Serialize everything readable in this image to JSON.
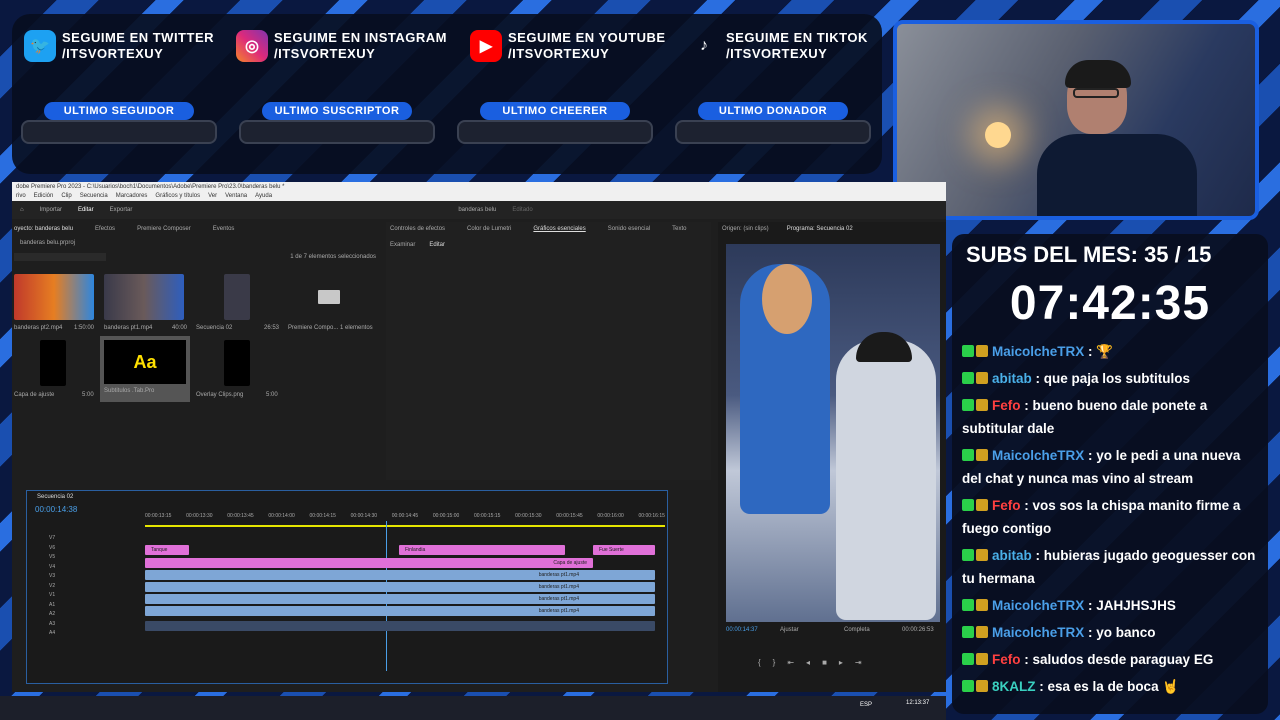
{
  "socials": [
    {
      "line1": "SEGUIME EN TWITTER",
      "line2": "/ITSVORTEXUY",
      "icon": "twitter-icon",
      "color": "#1da1f2"
    },
    {
      "line1": "SEGUIME EN INSTAGRAM",
      "line2": "/ITSVORTEXUY",
      "icon": "instagram-icon",
      "color": "#d6249f"
    },
    {
      "line1": "SEGUIME EN YOUTUBE",
      "line2": "/ITSVORTEXUY",
      "icon": "youtube-icon",
      "color": "#ff0000"
    },
    {
      "line1": "SEGUIME EN TIKTOK",
      "line2": "/ITSVORTEXUY",
      "icon": "tiktok-icon",
      "color": "#000000"
    }
  ],
  "labels": [
    "ULTIMO SEGUIDOR",
    "ULTIMO SUSCRIPTOR",
    "ULTIMO CHEERER",
    "ULTIMO DONADOR"
  ],
  "subs": "SUBS DEL MES: 35 / 15",
  "timer": "07:42:35",
  "chat": [
    {
      "user": "MaicolcheTRX",
      "color": "#4a9fe8",
      "text": ": 🏆"
    },
    {
      "user": "abitab",
      "color": "#4ab0e8",
      "text": ": que paja los subtitulos"
    },
    {
      "user": "Fefo",
      "color": "#ff4040",
      "text": ": bueno bueno dale ponete a subtitular dale"
    },
    {
      "user": "MaicolcheTRX",
      "color": "#4a9fe8",
      "text": ": yo le pedi a una nueva del chat y nunca mas vino al stream"
    },
    {
      "user": "Fefo",
      "color": "#ff4040",
      "text": ": vos sos la chispa manito firme a fuego contigo"
    },
    {
      "user": "abitab",
      "color": "#4ab0e8",
      "text": ": hubieras jugado geoguesser con tu hermana"
    },
    {
      "user": "MaicolcheTRX",
      "color": "#4a9fe8",
      "text": ": JAHJHSJHS"
    },
    {
      "user": "MaicolcheTRX",
      "color": "#4a9fe8",
      "text": ": yo banco"
    },
    {
      "user": "Fefo",
      "color": "#ff4040",
      "text": ": saludos desde paraguay EG"
    },
    {
      "user": "8KALZ",
      "color": "#3ad0c0",
      "text": ": esa es la de boca 🤘"
    }
  ],
  "premiere": {
    "title": "dobe Premiere Pro 2023 - C:\\Usuarios\\boch1\\Documentos\\Adobe\\Premiere Pro\\23.0\\banderas belu *",
    "menu": [
      "rivo",
      "Edición",
      "Clip",
      "Secuencia",
      "Marcadores",
      "Gráficos y títulos",
      "Ver",
      "Ventana",
      "Ayuda"
    ],
    "workspaces": [
      "Importar",
      "Editar",
      "Exportar"
    ],
    "active_workspace": "Editar",
    "project_name": "banderas belu",
    "edited_label": "Editado",
    "project_tabs": [
      "oyecto: banderas belu",
      "Efectos",
      "Premiere Composer",
      "Eventos"
    ],
    "project_file": "banderas belu.prproj",
    "selection_info": "1 de 7 elementos seleccionados",
    "items": [
      {
        "name": "banderas pt2.mp4",
        "dur": "1:50:00"
      },
      {
        "name": "banderas pt1.mp4",
        "dur": "40:00"
      },
      {
        "name": "Secuencia 02",
        "dur": "26:53"
      },
      {
        "name": "Premiere Compo...",
        "dur": "1 elementos"
      },
      {
        "name": "Capa de ajuste",
        "dur": "5:00"
      },
      {
        "name": "Subtitulos .Tab.Pro",
        "dur": ""
      },
      {
        "name": "Overlay Clips.png",
        "dur": "5:00"
      }
    ],
    "effects_tabs": [
      "Controles de efectos",
      "Color de Lumetri",
      "Gráficos esenciales",
      "Sonido esencial",
      "Texto"
    ],
    "effects_subtabs": [
      "Examinar",
      "Editar"
    ],
    "source_tab": "Origen: (sin clips)",
    "program_tab": "Programa: Secuencia 02",
    "program_time": "00:00:14:37",
    "program_fit": "Ajustar",
    "program_quality": "Completa",
    "program_duration": "00:00:26:53",
    "sequence_name": "Secuencia 02",
    "timecode": "00:00:14:38",
    "ruler": [
      "00:00:13:15",
      "00:00:13:30",
      "00:00:13:45",
      "00:00:14:00",
      "00:00:14:15",
      "00:00:14:30",
      "00:00:14:45",
      "00:00:15:00",
      "00:00:15:15",
      "00:00:15:30",
      "00:00:15:45",
      "00:00:16:00",
      "00:00:16:15"
    ],
    "clips": {
      "tanque": "Tanque",
      "finlandia": "Finlandia",
      "fue_suerte": "Fue Suerte",
      "capa": "Capa de ajuste",
      "bp1": "banderas pt1.mp4"
    },
    "tracks": [
      "V7",
      "V6",
      "V5",
      "V4",
      "V3",
      "V2",
      "V1",
      "A1",
      "A2",
      "A3",
      "A4"
    ],
    "clock": "12:13:37",
    "lang": "ESP"
  }
}
